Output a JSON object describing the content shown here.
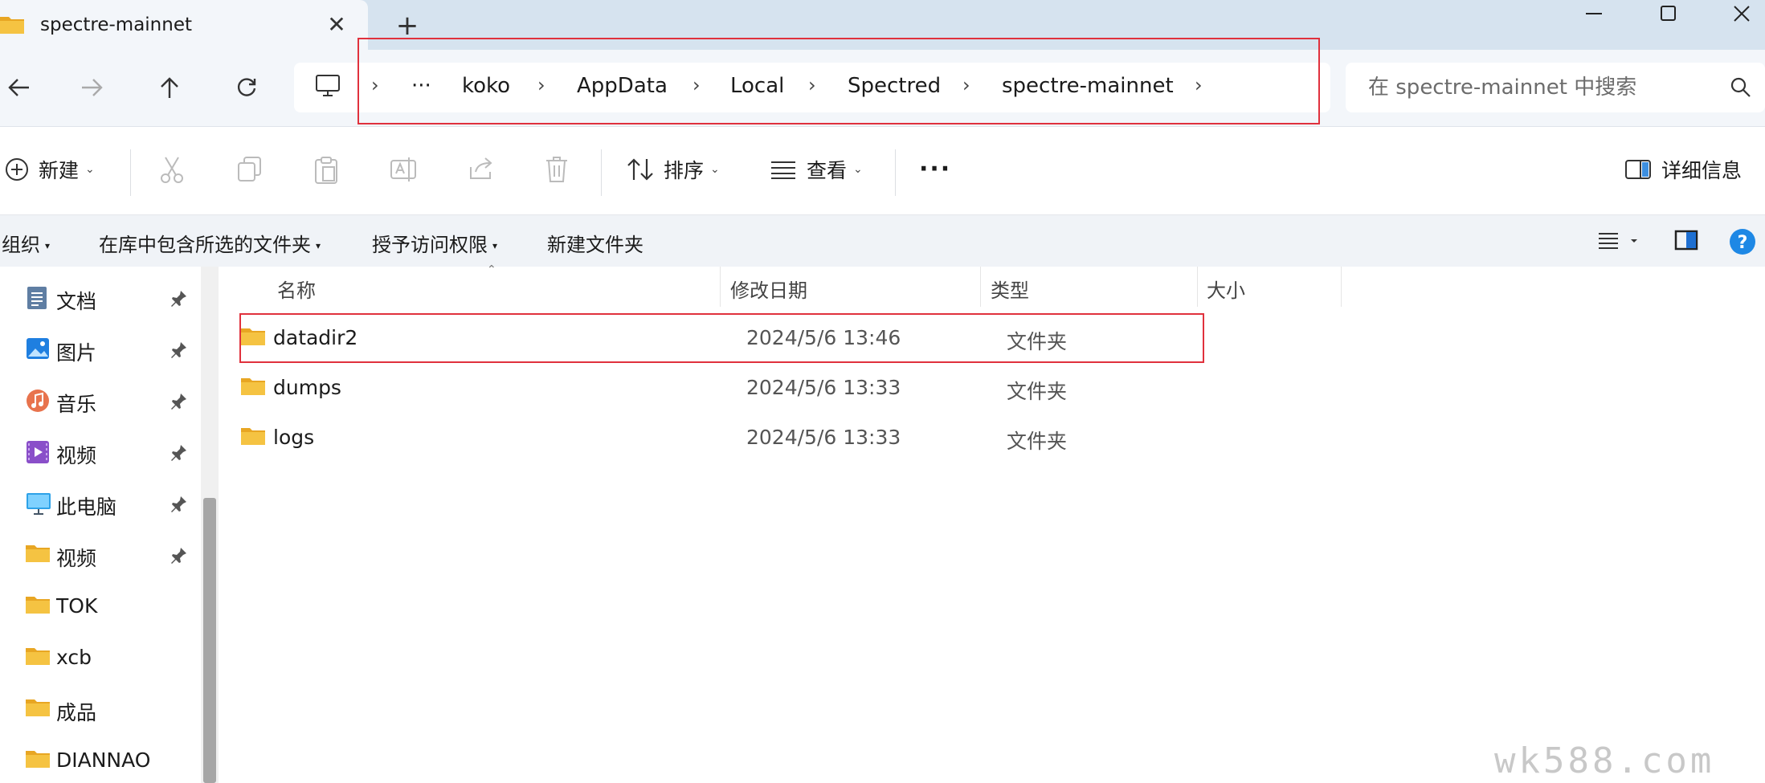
{
  "tab": {
    "title": "spectre-mainnet",
    "close_icon": "close-icon",
    "new_tab_icon": "plus-icon"
  },
  "window": {
    "minimize_icon": "minimize-icon",
    "maximize_icon": "maximize-icon",
    "close_icon": "close-icon"
  },
  "nav": {
    "back_icon": "arrow-left-icon",
    "forward_icon": "arrow-right-icon",
    "up_icon": "arrow-up-icon",
    "refresh_icon": "refresh-icon"
  },
  "address": {
    "more": "···",
    "crumbs": [
      "koko",
      "AppData",
      "Local",
      "Spectred",
      "spectre-mainnet"
    ]
  },
  "search": {
    "placeholder": "在 spectre-mainnet 中搜索"
  },
  "toolbar": {
    "new_label": "新建",
    "sort_label": "排序",
    "view_label": "查看",
    "more_label": "···",
    "details_label": "详细信息"
  },
  "library": {
    "organize": "组织",
    "include": "在库中包含所选的文件夹",
    "grant": "授予访问权限",
    "new_folder": "新建文件夹"
  },
  "sidebar": {
    "items": [
      {
        "label": "文档",
        "icon": "documents-icon",
        "pinned": true
      },
      {
        "label": "图片",
        "icon": "pictures-icon",
        "pinned": true
      },
      {
        "label": "音乐",
        "icon": "music-icon",
        "pinned": true
      },
      {
        "label": "视频",
        "icon": "videos-icon",
        "pinned": true
      },
      {
        "label": "此电脑",
        "icon": "computer-icon",
        "pinned": true
      },
      {
        "label": "视频",
        "icon": "folder-icon",
        "pinned": true
      },
      {
        "label": "TOK",
        "icon": "folder-icon",
        "pinned": false
      },
      {
        "label": "xcb",
        "icon": "folder-icon",
        "pinned": false
      },
      {
        "label": "成品",
        "icon": "folder-icon",
        "pinned": false
      },
      {
        "label": "DIANNAO",
        "icon": "folder-icon",
        "pinned": false
      }
    ]
  },
  "columns": {
    "name": "名称",
    "modified": "修改日期",
    "type": "类型",
    "size": "大小"
  },
  "files": [
    {
      "name": "datadir2",
      "modified": "2024/5/6 13:46",
      "type": "文件夹"
    },
    {
      "name": "dumps",
      "modified": "2024/5/6 13:33",
      "type": "文件夹"
    },
    {
      "name": "logs",
      "modified": "2024/5/6 13:33",
      "type": "文件夹"
    }
  ],
  "watermark": "wk588.com",
  "colors": {
    "highlight": "#e0313d",
    "folder": "#f5c342",
    "titlebar": "#d6e3ef"
  }
}
